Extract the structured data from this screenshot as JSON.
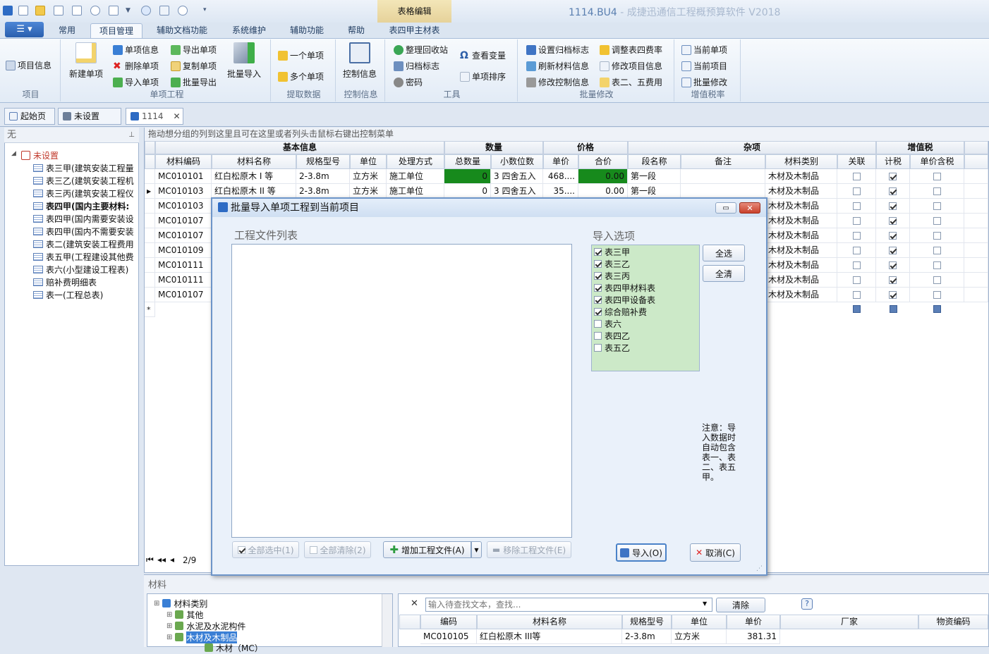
{
  "window": {
    "title_file": "1114.BU4",
    "title_app": " - 成捷迅通信工程概预算软件 V2018",
    "context_group": "表格编辑"
  },
  "ribbon": {
    "tabs": [
      "常用",
      "项目管理",
      "辅助文档功能",
      "系统维护",
      "辅助功能",
      "帮助",
      "表四甲主材表"
    ],
    "groups": {
      "project": {
        "label": "项目",
        "items": [
          "项目信息"
        ]
      },
      "single": {
        "label": "单项工程",
        "new": "新建单项",
        "col1": [
          "单项信息",
          "删除单项",
          "导入单项"
        ],
        "col2": [
          "导出单项",
          "复制单项",
          "批量导出"
        ],
        "batch_import": "批量导入"
      },
      "extract": {
        "label": "提取数据",
        "items": [
          "一个单项",
          "多个单项"
        ]
      },
      "control": {
        "label": "控制信息",
        "items": [
          "控制信息"
        ]
      },
      "tools": {
        "label": "工具",
        "col1": [
          "整理回收站",
          "归档标志",
          "密码"
        ],
        "col2": [
          "查看变量",
          "单项排序"
        ]
      },
      "batchmod": {
        "label": "批量修改",
        "col1": [
          "设置归档标志",
          "刷新材料信息",
          "修改控制信息"
        ],
        "col2": [
          "调整表四费率",
          "修改项目信息",
          "表二、五费用"
        ]
      },
      "vat": {
        "label": "增值税率",
        "items": [
          "当前单项",
          "当前项目",
          "批量修改"
        ]
      }
    }
  },
  "doc_tabs": [
    "起始页",
    "未设置",
    "1114"
  ],
  "left_panel": {
    "header": "无",
    "root": "未设置",
    "items": [
      "表三甲(建筑安装工程量",
      "表三乙(建筑安装工程机",
      "表三丙(建筑安装工程仪",
      "表四甲(国内主要材料:",
      "表四甲(国内需要安装设",
      "表四甲(国内不需要安装",
      "表二(建筑安装工程费用",
      "表五甲(工程建设其他费",
      "表六(小型建设工程表)",
      "赔补费明细表",
      "表一(工程总表)"
    ]
  },
  "grid": {
    "group_hint": "拖动想分组的列到这里且可在这里或者列头击鼠标右键出控制菜单",
    "groups": [
      "基本信息",
      "数量",
      "价格",
      "杂项",
      "增值税"
    ],
    "columns": [
      "材料编码",
      "材料名称",
      "规格型号",
      "单位",
      "处理方式",
      "总数量",
      "小数位数",
      "单价",
      "合价",
      "段名称",
      "备注",
      "材料类别",
      "关联",
      "计税",
      "单价含税"
    ],
    "rows": [
      {
        "code": "MC010101",
        "name": "红白松原木 I 等",
        "spec": "2-3.8m",
        "unit": "立方米",
        "proc": "施工单位",
        "qty": "0",
        "dec": "3 四舍五入",
        "price": "468....",
        "total": "0.00",
        "seg": "第一段",
        "cat": "木材及木制品"
      },
      {
        "code": "MC010103",
        "name": "红白松原木 II 等",
        "spec": "2-3.8m",
        "unit": "立方米",
        "proc": "施工单位",
        "qty": "0",
        "dec": "3 四舍五入",
        "price": "35....",
        "total": "0.00",
        "seg": "第一段",
        "cat": "木材及木制品"
      },
      {
        "code": "MC010103",
        "cat": "木材及木制品"
      },
      {
        "code": "MC010107",
        "cat": "木材及木制品"
      },
      {
        "code": "MC010107",
        "cat": "木材及木制品"
      },
      {
        "code": "MC010109",
        "cat": "木材及木制品"
      },
      {
        "code": "MC010111",
        "cat": "木材及木制品"
      },
      {
        "code": "MC010111",
        "cat": "木材及木制品"
      },
      {
        "code": "MC010107",
        "cat": "木材及木制品"
      }
    ],
    "pager": "2/9"
  },
  "material": {
    "title": "材料",
    "tree": [
      "材料类别",
      "其他",
      "水泥及水泥构件",
      "木材及木制品",
      "木材（MC）"
    ],
    "search_placeholder": "输入待查找文本，查找...",
    "clear": "清除",
    "columns": [
      "编码",
      "材料名称",
      "规格型号",
      "单位",
      "单价",
      "厂家",
      "物资编码"
    ],
    "row": {
      "code": "MC010105",
      "name": "红白松原木 III等",
      "spec": "2-3.8m",
      "unit": "立方米",
      "price": "381.31"
    }
  },
  "dialog": {
    "title": "批量导入单项工程到当前项目",
    "file_list_label": "工程文件列表",
    "options_label": "导入选项",
    "options": [
      {
        "label": "表三甲",
        "checked": true
      },
      {
        "label": "表三乙",
        "checked": true
      },
      {
        "label": "表三丙",
        "checked": true
      },
      {
        "label": "表四甲材料表",
        "checked": true
      },
      {
        "label": "表四甲设备表",
        "checked": true
      },
      {
        "label": "综合赔补费",
        "checked": true
      },
      {
        "label": "表六",
        "checked": false
      },
      {
        "label": "表四乙",
        "checked": false
      },
      {
        "label": "表五乙",
        "checked": false
      }
    ],
    "select_all": "全选",
    "clear_all": "全清",
    "note": "注意：导入数据时自动包含表一、表二、表五甲。",
    "btn_select_all": "全部选中(1)",
    "btn_clear_all": "全部清除(2)",
    "btn_add": "增加工程文件(A)",
    "btn_remove": "移除工程文件(E)",
    "btn_import": "导入(O)",
    "btn_cancel": "取消(C)"
  }
}
